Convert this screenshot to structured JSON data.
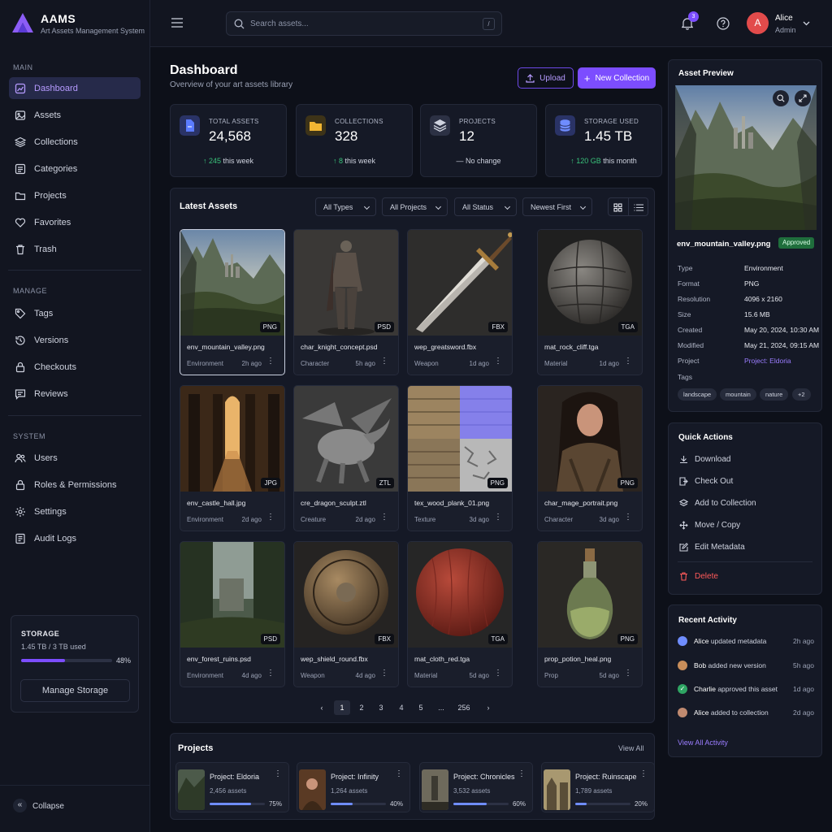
{
  "brand": {
    "name": "AAMS",
    "subtitle": "Art Assets Management System"
  },
  "sidebar": {
    "sections": {
      "main": "MAIN",
      "manage": "MANAGE",
      "system": "SYSTEM"
    },
    "main_items": [
      {
        "label": "Dashboard",
        "icon": "dashboard-icon"
      },
      {
        "label": "Assets",
        "icon": "image-icon"
      },
      {
        "label": "Collections",
        "icon": "layers-icon"
      },
      {
        "label": "Categories",
        "icon": "category-icon"
      },
      {
        "label": "Projects",
        "icon": "folder-icon"
      },
      {
        "label": "Favorites",
        "icon": "heart-icon"
      },
      {
        "label": "Trash",
        "icon": "trash-icon"
      }
    ],
    "manage_items": [
      {
        "label": "Tags",
        "icon": "tag-icon"
      },
      {
        "label": "Versions",
        "icon": "history-icon"
      },
      {
        "label": "Checkouts",
        "icon": "lock-icon"
      },
      {
        "label": "Reviews",
        "icon": "review-icon"
      }
    ],
    "system_items": [
      {
        "label": "Users",
        "icon": "users-icon"
      },
      {
        "label": "Roles & Permissions",
        "icon": "lock-icon"
      },
      {
        "label": "Settings",
        "icon": "gear-icon"
      },
      {
        "label": "Audit Logs",
        "icon": "log-icon"
      }
    ],
    "storage": {
      "title": "STORAGE",
      "used_text": "1.45 TB / 3 TB used",
      "percent_label": "48%",
      "percent": 48,
      "button": "Manage Storage"
    },
    "collapse": "Collapse"
  },
  "topbar": {
    "search_placeholder": "Search assets...",
    "search_shortcut": "/",
    "notifications": "3",
    "user": {
      "initial": "A",
      "name": "Alice",
      "role": "Admin"
    }
  },
  "page": {
    "title": "Dashboard",
    "subtitle": "Overview of your art assets library",
    "upload": "Upload",
    "new_collection": "New Collection"
  },
  "stats": [
    {
      "label": "TOTAL ASSETS",
      "value": "24,568",
      "delta": "245",
      "delta_suffix": "this week",
      "color": "#5b7bff"
    },
    {
      "label": "COLLECTIONS",
      "value": "328",
      "delta": "8",
      "delta_suffix": "this week",
      "color": "#f2b632"
    },
    {
      "label": "PROJECTS",
      "value": "12",
      "delta": "",
      "delta_suffix": "No change",
      "color": "#8a93ad"
    },
    {
      "label": "STORAGE USED",
      "value": "1.45 TB",
      "delta": "120 GB",
      "delta_suffix": "this month",
      "color": "#6f8dff"
    }
  ],
  "latest": {
    "title": "Latest Assets",
    "filters": [
      "All Types",
      "All Projects",
      "All Status",
      "Newest First"
    ],
    "assets": [
      {
        "name": "env_mountain_valley.png",
        "category": "Environment",
        "ago": "2h ago",
        "format": "PNG"
      },
      {
        "name": "char_knight_concept.psd",
        "category": "Character",
        "ago": "5h ago",
        "format": "PSD"
      },
      {
        "name": "wep_greatsword.fbx",
        "category": "Weapon",
        "ago": "1d ago",
        "format": "FBX"
      },
      {
        "name": "mat_rock_cliff.tga",
        "category": "Material",
        "ago": "1d ago",
        "format": "TGA"
      },
      {
        "name": "env_castle_hall.jpg",
        "category": "Environment",
        "ago": "2d ago",
        "format": "JPG"
      },
      {
        "name": "cre_dragon_sculpt.ztl",
        "category": "Creature",
        "ago": "2d ago",
        "format": "ZTL"
      },
      {
        "name": "tex_wood_plank_01.png",
        "category": "Texture",
        "ago": "3d ago",
        "format": "PNG"
      },
      {
        "name": "char_mage_portrait.png",
        "category": "Character",
        "ago": "3d ago",
        "format": "PNG"
      },
      {
        "name": "env_forest_ruins.psd",
        "category": "Environment",
        "ago": "4d ago",
        "format": "PSD"
      },
      {
        "name": "wep_shield_round.fbx",
        "category": "Weapon",
        "ago": "4d ago",
        "format": "FBX"
      },
      {
        "name": "mat_cloth_red.tga",
        "category": "Material",
        "ago": "5d ago",
        "format": "TGA"
      },
      {
        "name": "prop_potion_heal.png",
        "category": "Prop",
        "ago": "5d ago",
        "format": "PNG"
      }
    ],
    "pagination": [
      "1",
      "2",
      "3",
      "4",
      "5",
      "...",
      "256"
    ]
  },
  "projects": {
    "title": "Projects",
    "view_all": "View All",
    "items": [
      {
        "name": "Project: Eldoria",
        "count": "2,456 assets",
        "pct_label": "75%",
        "pct": 75
      },
      {
        "name": "Project: Infinity",
        "count": "1,264 assets",
        "pct_label": "40%",
        "pct": 40
      },
      {
        "name": "Project: Chronicles",
        "count": "3,532 assets",
        "pct_label": "60%",
        "pct": 60
      },
      {
        "name": "Project: Ruinscape",
        "count": "1,789 assets",
        "pct_label": "20%",
        "pct": 20
      }
    ]
  },
  "preview": {
    "title": "Asset Preview",
    "filename": "env_mountain_valley.png",
    "status": "Approved",
    "props": [
      {
        "k": "Type",
        "v": "Environment"
      },
      {
        "k": "Format",
        "v": "PNG"
      },
      {
        "k": "Resolution",
        "v": "4096 x 2160"
      },
      {
        "k": "Size",
        "v": "15.6 MB"
      },
      {
        "k": "Created",
        "v": "May 20, 2024, 10:30 AM"
      },
      {
        "k": "Modified",
        "v": "May 21, 2024, 09:15 AM"
      },
      {
        "k": "Project",
        "v": "Project: Eldoria"
      },
      {
        "k": "Tags",
        "v": ""
      }
    ],
    "tags": [
      "landscape",
      "mountain",
      "nature",
      "+2"
    ]
  },
  "quick_actions": {
    "title": "Quick Actions",
    "items": [
      "Download",
      "Check Out",
      "Add to Collection",
      "Move / Copy",
      "Edit Metadata"
    ],
    "delete": "Delete"
  },
  "activity": {
    "title": "Recent Activity",
    "items": [
      {
        "user": "Alice",
        "text": "updated metadata",
        "ago": "2h ago"
      },
      {
        "user": "Bob",
        "text": "added new version",
        "ago": "5h ago"
      },
      {
        "user": "Charlie",
        "text": "approved this asset",
        "ago": "1d ago"
      },
      {
        "user": "Alice",
        "text": "added to collection",
        "ago": "2d ago"
      }
    ],
    "view_all": "View All Activity"
  },
  "colors": {
    "accent": "#7c4dff",
    "success": "#39c27a",
    "danger": "#ff5a5a",
    "link": "#9b7dff"
  }
}
